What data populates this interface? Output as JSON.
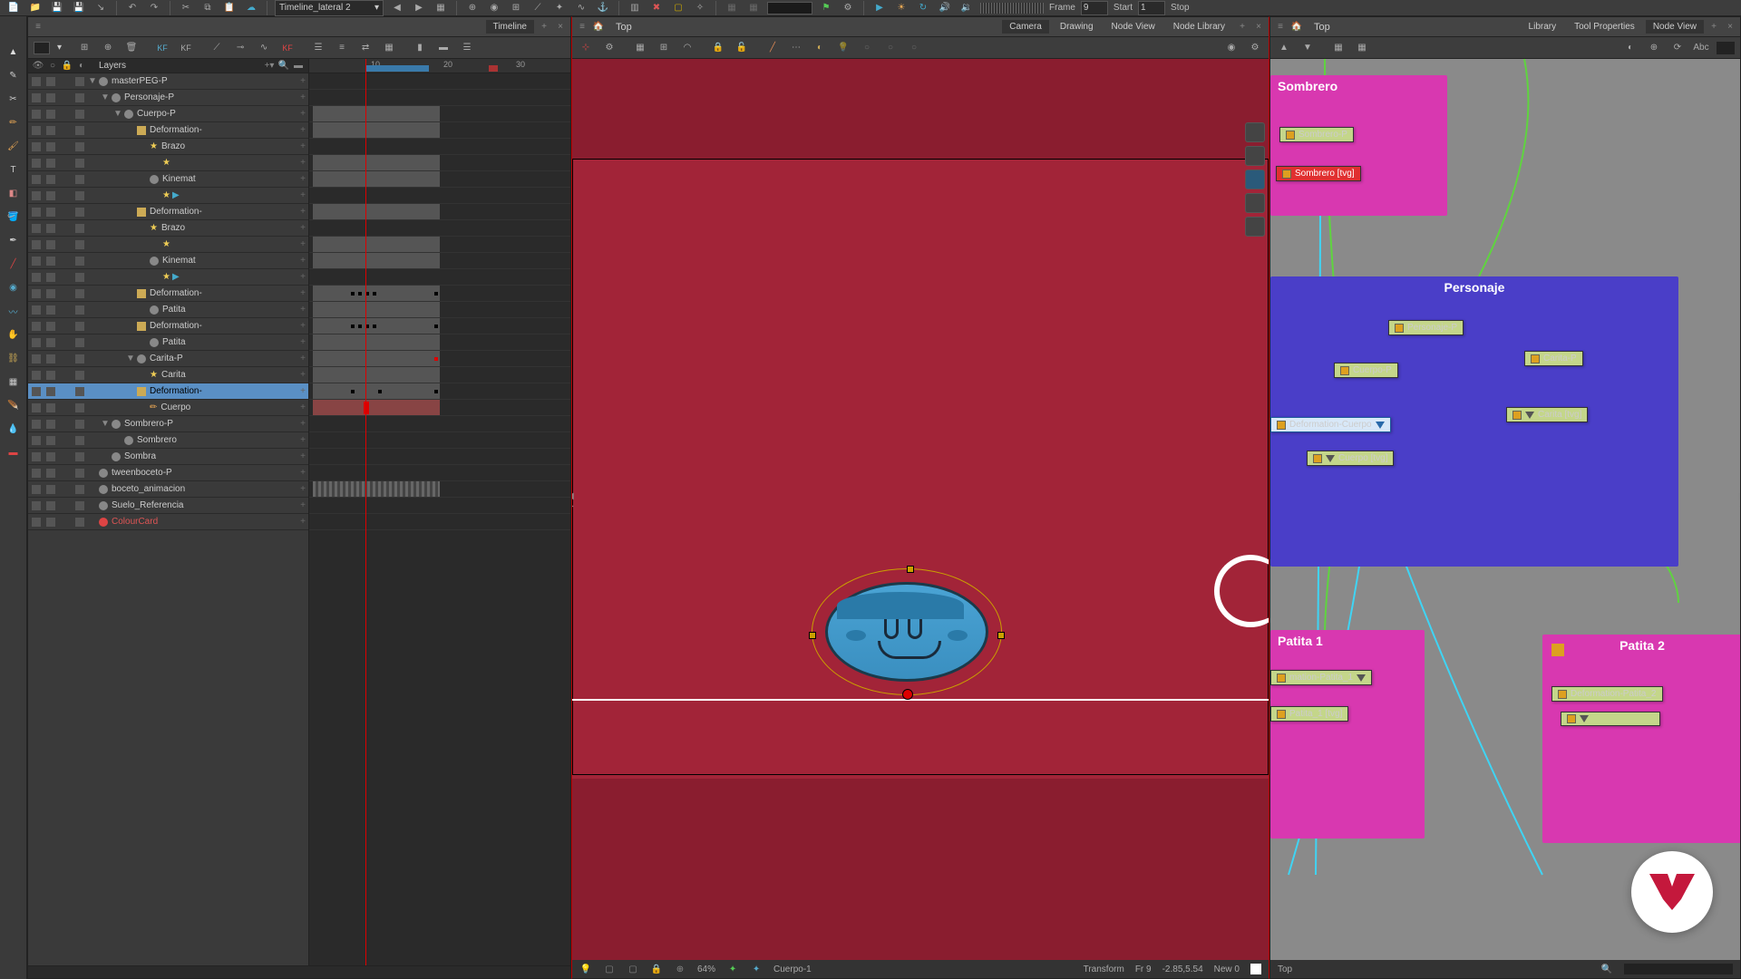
{
  "top_toolbar": {
    "scene_name": "Timeline_lateral 2",
    "frame_label": "Frame",
    "frame_value": "9",
    "start_label": "Start",
    "start_value": "1",
    "stop_label": "Stop"
  },
  "timeline_panel": {
    "tab": "Timeline",
    "layers_label": "Layers",
    "kf1": "KF",
    "kf2": "KF",
    "kf3": "KF",
    "ruler": {
      "m10": "10",
      "m20": "20",
      "m30": "30"
    },
    "layers": [
      {
        "name": "masterPEG-P",
        "indent": 0,
        "expanded": true
      },
      {
        "name": "Personaje-P",
        "indent": 1,
        "expanded": true
      },
      {
        "name": "Cuerpo-P",
        "indent": 2,
        "expanded": true
      },
      {
        "name": "Deformation-",
        "indent": 3,
        "icon": "def"
      },
      {
        "name": "Brazo",
        "indent": 4,
        "icon": "star"
      },
      {
        "name": "",
        "indent": 5,
        "icon": "star"
      },
      {
        "name": "Kinemat",
        "indent": 4
      },
      {
        "name": "",
        "indent": 5,
        "icon": "mix"
      },
      {
        "name": "Deformation-",
        "indent": 3,
        "icon": "def"
      },
      {
        "name": "Brazo",
        "indent": 4,
        "icon": "star"
      },
      {
        "name": "",
        "indent": 5,
        "icon": "star"
      },
      {
        "name": "Kinemat",
        "indent": 4
      },
      {
        "name": "",
        "indent": 5,
        "icon": "mix"
      },
      {
        "name": "Deformation-",
        "indent": 3,
        "icon": "def"
      },
      {
        "name": "Patita",
        "indent": 4
      },
      {
        "name": "Deformation-",
        "indent": 3,
        "icon": "def"
      },
      {
        "name": "Patita",
        "indent": 4
      },
      {
        "name": "Carita-P",
        "indent": 3,
        "expanded": true
      },
      {
        "name": "Carita",
        "indent": 4,
        "icon": "star"
      },
      {
        "name": "Deformation-",
        "indent": 3,
        "icon": "def",
        "selected": true
      },
      {
        "name": "Cuerpo",
        "indent": 4,
        "icon": "pencil"
      },
      {
        "name": "Sombrero-P",
        "indent": 1,
        "expanded": true
      },
      {
        "name": "Sombrero",
        "indent": 2
      },
      {
        "name": "Sombra",
        "indent": 1
      },
      {
        "name": "tweenboceto-P",
        "indent": 0
      },
      {
        "name": "boceto_animacion",
        "indent": 0
      },
      {
        "name": "Suelo_Referencia",
        "indent": 0
      },
      {
        "name": "ColourCard",
        "indent": 0,
        "red": true
      }
    ]
  },
  "camera_panel": {
    "top": "Top",
    "tabs": {
      "camera": "Camera",
      "drawing": "Drawing",
      "nodeview": "Node View",
      "nodelib": "Node Library"
    },
    "status": {
      "zoom": "64%",
      "object": "Cuerpo-1",
      "tool": "Transform",
      "frame": "Fr 9",
      "coords": "-2.85,5.54",
      "new": "New 0"
    }
  },
  "node_panel": {
    "top": "Top",
    "tabs": {
      "library": "Library",
      "toolprops": "Tool Properties",
      "nodeview": "Node View"
    },
    "groups": {
      "sombrero": {
        "title": "Sombrero",
        "n1": "Sombrero-P",
        "n2": "Sombrero  [tvg]"
      },
      "personaje": {
        "title": "Personaje",
        "n1": "Personaje-P",
        "n2": "Cuerpo-P",
        "n3": "Carita-P",
        "n4": "Carita  [tvg]",
        "n5": "Deformation-Cuerpo",
        "n6": "Cuerpo  [tvg]"
      },
      "patita1": {
        "title": "Patita 1",
        "n1": "mation-Patita_1",
        "n2": "Patita_1  [tvg]"
      },
      "patita2": {
        "title": "Patita 2",
        "n1": "Deformation-Patita_2"
      }
    },
    "status": "Top"
  }
}
